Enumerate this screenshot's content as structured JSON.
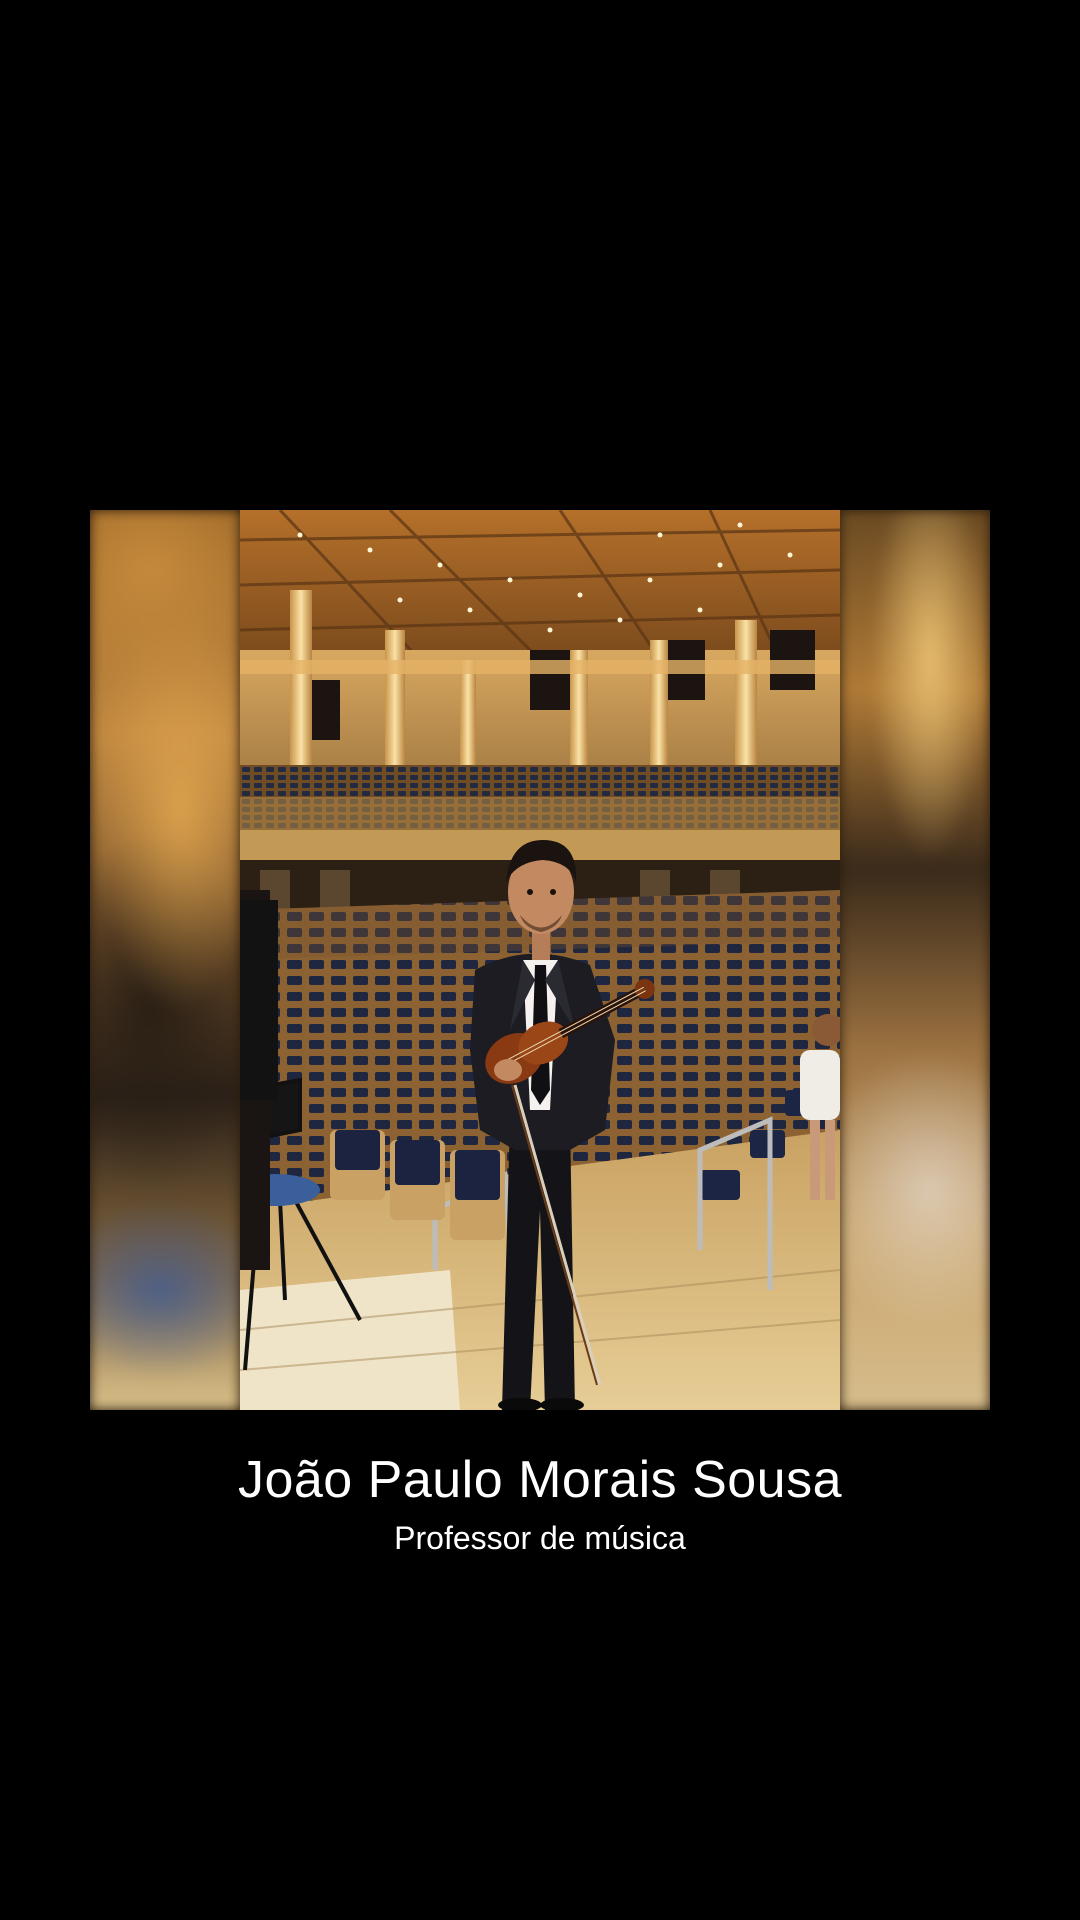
{
  "profile": {
    "name": "João Paulo Morais Sousa",
    "role": "Professor de música"
  },
  "photo": {
    "subject": "violinist-in-concert-hall"
  },
  "colors": {
    "background": "#000000",
    "text": "#ffffff",
    "hall_wood": "#c8913c",
    "seat_blue": "#1c2a4a"
  }
}
